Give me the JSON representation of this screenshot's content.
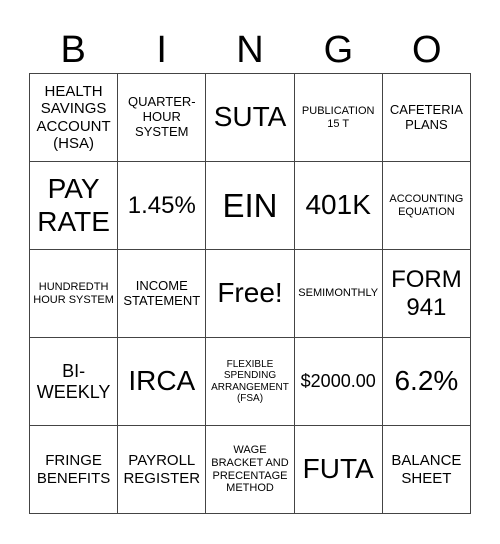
{
  "header": {
    "letters": [
      "B",
      "I",
      "N",
      "G",
      "O"
    ]
  },
  "cells": [
    {
      "text": "HEALTH SAVINGS ACCOUNT (HSA)",
      "size": "s-lg"
    },
    {
      "text": "QUARTER-HOUR SYSTEM",
      "size": "s-md"
    },
    {
      "text": "SUTA",
      "size": "s-big"
    },
    {
      "text": "PUBLICATION 15 T",
      "size": "s-sm"
    },
    {
      "text": "CAFETERIA PLANS",
      "size": "s-md"
    },
    {
      "text": "PAY RATE",
      "size": "s-big"
    },
    {
      "text": "1.45%",
      "size": "s-xxl"
    },
    {
      "text": "EIN",
      "size": "s-huge"
    },
    {
      "text": "401K",
      "size": "s-big"
    },
    {
      "text": "ACCOUNTING EQUATION",
      "size": "s-sm"
    },
    {
      "text": "HUNDREDTH HOUR SYSTEM",
      "size": "s-sm"
    },
    {
      "text": "INCOME STATEMENT",
      "size": "s-md"
    },
    {
      "text": "Free!",
      "size": "s-big"
    },
    {
      "text": "SEMIMONTHLY",
      "size": "s-sm"
    },
    {
      "text": "FORM 941",
      "size": "s-xxl"
    },
    {
      "text": "BI-WEEKLY",
      "size": "s-xl"
    },
    {
      "text": "IRCA",
      "size": "s-big"
    },
    {
      "text": "FLEXIBLE SPENDING ARRANGEMENT (FSA)",
      "size": "s-xs"
    },
    {
      "text": "$2000.00",
      "size": "s-xl"
    },
    {
      "text": "6.2%",
      "size": "s-big"
    },
    {
      "text": "FRINGE BENEFITS",
      "size": "s-lg"
    },
    {
      "text": "PAYROLL REGISTER",
      "size": "s-lg"
    },
    {
      "text": "WAGE BRACKET AND PRECENTAGE METHOD",
      "size": "s-sm"
    },
    {
      "text": "FUTA",
      "size": "s-big"
    },
    {
      "text": "BALANCE SHEET",
      "size": "s-lg"
    }
  ]
}
